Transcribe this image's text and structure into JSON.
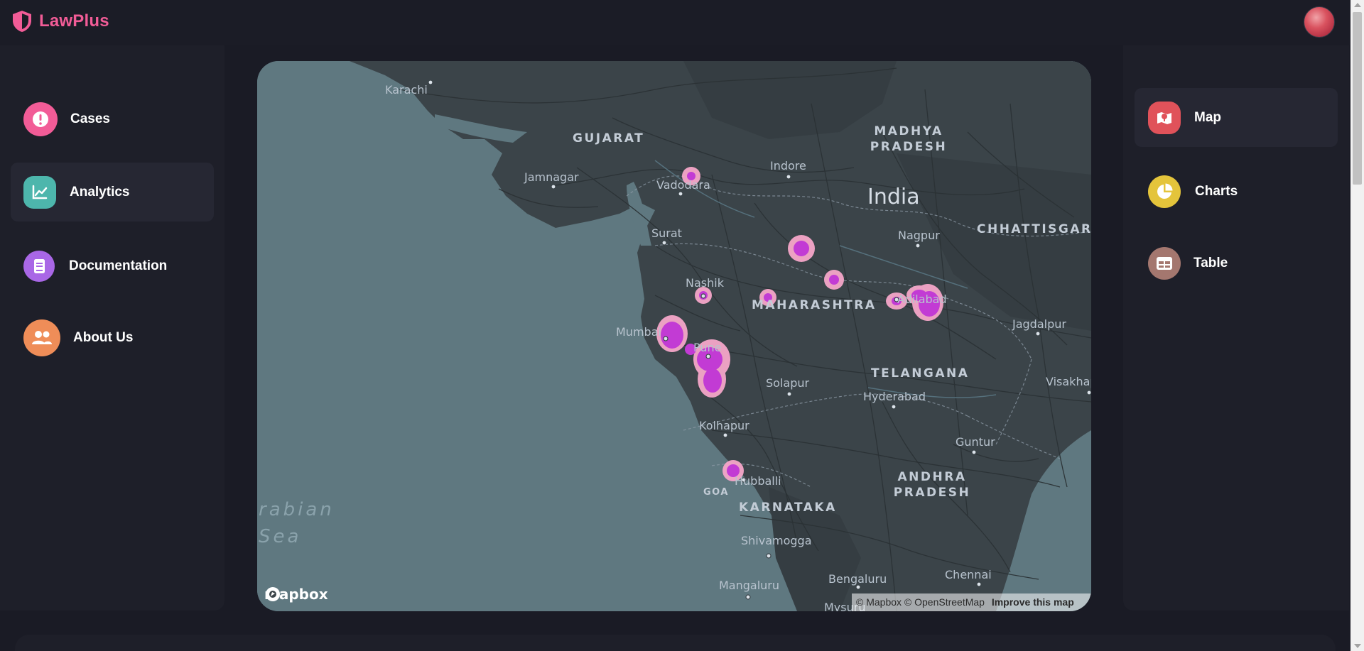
{
  "app": {
    "name": "LawPlus"
  },
  "colors": {
    "brand": "#f25c97",
    "background": "#1a1b25",
    "panel": "#1e1f29",
    "active_item": "#262733",
    "heat": "#c23bd4"
  },
  "left_nav": [
    {
      "label": "Cases",
      "icon": "alert-circle-icon",
      "icon_color": "#f25c97"
    },
    {
      "label": "Analytics",
      "icon": "line-chart-icon",
      "icon_color": "#4db6ac",
      "active": true
    },
    {
      "label": "Documentation",
      "icon": "document-icon",
      "icon_color": "#a967e6"
    },
    {
      "label": "About Us",
      "icon": "users-icon",
      "icon_color": "#ef8d58"
    }
  ],
  "right_nav": [
    {
      "label": "Map",
      "icon": "map-icon",
      "icon_color": "#e0525a",
      "active": true
    },
    {
      "label": "Charts",
      "icon": "pie-chart-icon",
      "icon_color": "#e4c43b"
    },
    {
      "label": "Table",
      "icon": "table-icon",
      "icon_color": "#a4776f"
    }
  ],
  "map": {
    "country": "India",
    "states": [
      "GUJARAT",
      "MADHYA\nPRADESH",
      "MAHARASHTRA",
      "CHHATTISGARH",
      "TELANGANA",
      "ANDHRA\nPRADESH",
      "KARNATAKA",
      "GOA"
    ],
    "cities": [
      "Karachi",
      "Indore",
      "Jamnagar",
      "Vadodara",
      "Surat",
      "Nagpur",
      "Nashik",
      "Adilabad",
      "Mumbai",
      "Pune",
      "Jagdalpur",
      "Solapur",
      "Hyderabad",
      "Visakhap",
      "Kolhapur",
      "Guntur",
      "Hubballi",
      "Shivamogga",
      "Bengaluru",
      "Chennai",
      "Mangaluru",
      "Mysuru"
    ],
    "sea": "rabian\nSea",
    "provider_logo": "mapbox",
    "attribution": "© Mapbox © OpenStreetMap",
    "improve_link": "Improve this map"
  }
}
